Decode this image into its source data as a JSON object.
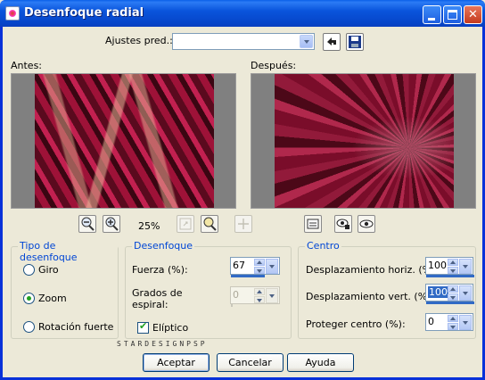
{
  "window": {
    "title": "Desenfoque radial"
  },
  "presets": {
    "label": "Ajustes pred.:",
    "value": ""
  },
  "preview": {
    "before_label": "Antes:",
    "after_label": "Después:",
    "zoom": "25%"
  },
  "blur_type": {
    "title": "Tipo de desenfoque",
    "options": [
      "Giro",
      "Zoom",
      "Rotación fuerte"
    ],
    "selected": "Zoom"
  },
  "blur": {
    "title": "Desenfoque",
    "strength_label": "Fuerza (%):",
    "strength_value": "67",
    "strength_fraction": 0.67,
    "spiral_label_1": "Grados de",
    "spiral_label_2": "espiral:",
    "spiral_value": "0",
    "elliptical_label": "Elíptico",
    "elliptical_checked": true
  },
  "center": {
    "title": "Centro",
    "h_offset_label": "Desplazamiento horiz. (%):",
    "h_offset_value": "100",
    "v_offset_label": "Desplazamiento vert. (%):",
    "v_offset_value": "100",
    "protect_label": "Proteger centro (%):",
    "protect_value": "0"
  },
  "watermark": "STARDESIGNPSP",
  "buttons": {
    "ok": "Aceptar",
    "cancel": "Cancelar",
    "help": "Ayuda"
  },
  "colors": {
    "titlebar": "#0A55DC",
    "dialog_bg": "#ECE9D8",
    "group_title": "#0046D5",
    "selection": "#316AC5",
    "image_accent": "#9E1238"
  }
}
